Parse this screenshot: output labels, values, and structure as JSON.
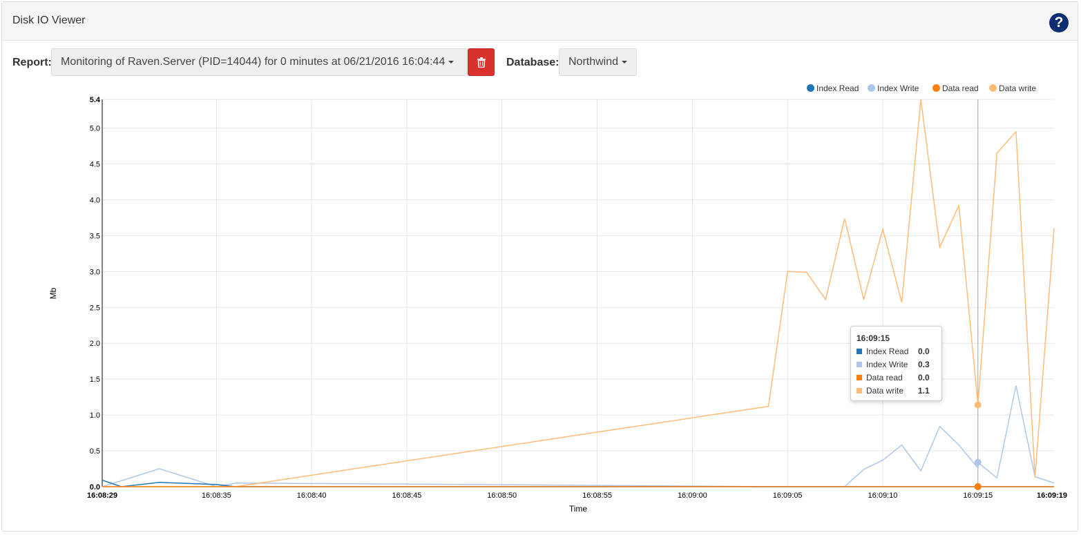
{
  "header": {
    "title": "Disk IO Viewer",
    "help_label": "?"
  },
  "toolbar": {
    "report_label": "Report:",
    "report_value": "Monitoring of Raven.Server (PID=14044) for 0 minutes at 06/21/2016 16:04:44",
    "database_label": "Database:",
    "database_value": "Northwind",
    "delete_icon": "trash-icon"
  },
  "colors": {
    "index_read": "#1f77b4",
    "index_write": "#aec7e8",
    "data_read": "#ff7f0e",
    "data_write": "#ffbb78",
    "delete_button": "#d9312b",
    "help_button": "#0c2d73"
  },
  "tooltip": {
    "title": "16:09:15",
    "rows": [
      {
        "name": "Index Read",
        "value": "0.0"
      },
      {
        "name": "Index Write",
        "value": "0.3"
      },
      {
        "name": "Data read",
        "value": "0.0"
      },
      {
        "name": "Data write",
        "value": "1.1"
      }
    ]
  },
  "chart_data": {
    "type": "line",
    "title": "",
    "xlabel": "Time",
    "ylabel": "Mb",
    "xlim": [
      0,
      50
    ],
    "ylim": [
      0,
      5.4
    ],
    "x_ticks": [
      {
        "x": 0,
        "label": "16:08:29"
      },
      {
        "x": 6,
        "label": "16:08:35"
      },
      {
        "x": 11,
        "label": "16:08:40"
      },
      {
        "x": 16,
        "label": "16:08:45"
      },
      {
        "x": 21,
        "label": "16:08:50"
      },
      {
        "x": 26,
        "label": "16:08:55"
      },
      {
        "x": 31,
        "label": "16:09:00"
      },
      {
        "x": 36,
        "label": "16:09:05"
      },
      {
        "x": 41,
        "label": "16:09:10"
      },
      {
        "x": 46,
        "label": "16:09:15"
      },
      {
        "x": 50,
        "label": "16:09:19"
      }
    ],
    "y_ticks": [
      0.0,
      0.5,
      1.0,
      1.5,
      2.0,
      2.5,
      3.0,
      3.5,
      4.0,
      4.5,
      5.0,
      5.4
    ],
    "y_tick_labels": [
      "0.0",
      "0.5",
      "1.0",
      "1.5",
      "2.0",
      "2.5",
      "3.0",
      "3.5",
      "4.0",
      "4.5",
      "5.0",
      "5.4"
    ],
    "grid": true,
    "legend": "top-right",
    "highlight_x": 46,
    "series": [
      {
        "name": "Index Read",
        "color": "#1f77b4",
        "points": [
          [
            0,
            0.09
          ],
          [
            1,
            0.0
          ],
          [
            3,
            0.06
          ],
          [
            6,
            0.03
          ],
          [
            7,
            0.0
          ],
          [
            50,
            0.0
          ]
        ]
      },
      {
        "name": "Index Write",
        "color": "#aec7e8",
        "points": [
          [
            0,
            0.0
          ],
          [
            3,
            0.25
          ],
          [
            6,
            0.0
          ],
          [
            7,
            0.05
          ],
          [
            20,
            0.03
          ],
          [
            35,
            0.0
          ],
          [
            39,
            0.0
          ],
          [
            40,
            0.24
          ],
          [
            41,
            0.37
          ],
          [
            42,
            0.58
          ],
          [
            43,
            0.22
          ],
          [
            44,
            0.84
          ],
          [
            45,
            0.58
          ],
          [
            46,
            0.26
          ],
          [
            46,
            0.34
          ],
          [
            47,
            0.12
          ],
          [
            48,
            1.41
          ],
          [
            49,
            0.14
          ],
          [
            50,
            0.05
          ]
        ]
      },
      {
        "name": "Data read",
        "color": "#ff7f0e",
        "points": [
          [
            0,
            0.0
          ],
          [
            50,
            0.0
          ]
        ]
      },
      {
        "name": "Data write",
        "color": "#ffbb78",
        "points": [
          [
            0,
            0.0
          ],
          [
            7,
            0.0
          ],
          [
            35,
            1.12
          ],
          [
            36,
            3.0
          ],
          [
            37,
            2.99
          ],
          [
            38,
            2.61
          ],
          [
            39,
            3.74
          ],
          [
            40,
            2.61
          ],
          [
            41,
            3.59
          ],
          [
            42,
            2.57
          ],
          [
            43,
            5.4
          ],
          [
            44,
            3.34
          ],
          [
            45,
            3.92
          ],
          [
            46,
            1.14
          ],
          [
            47,
            4.65
          ],
          [
            48,
            4.95
          ],
          [
            49,
            0.13
          ],
          [
            50,
            3.6
          ]
        ]
      }
    ]
  }
}
